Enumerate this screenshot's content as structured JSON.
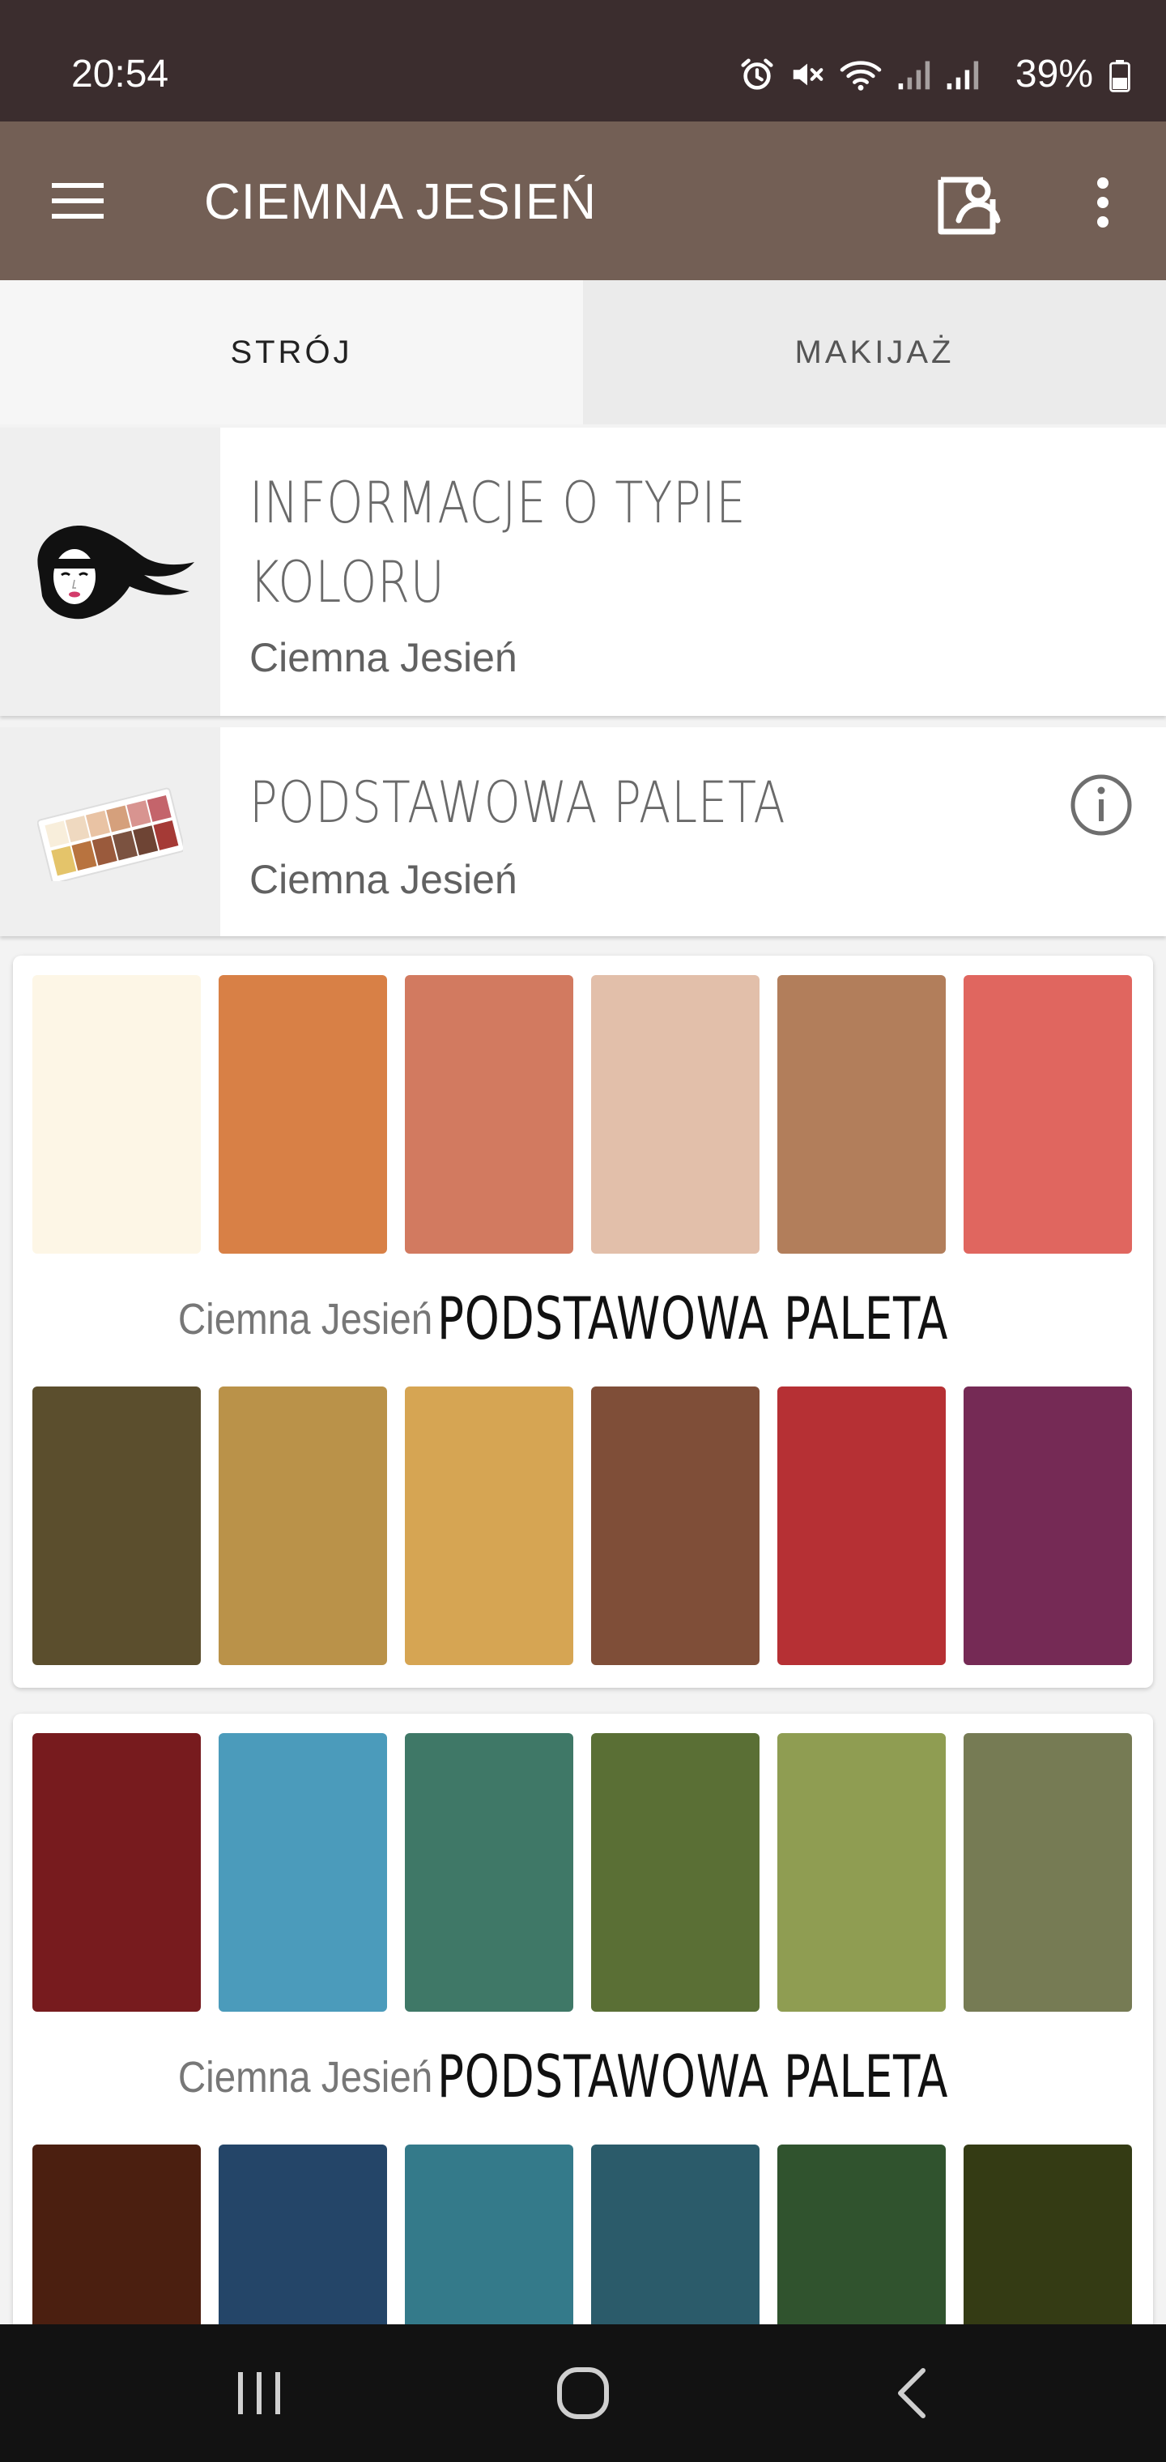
{
  "status_bar": {
    "time": "20:54",
    "battery": "39%",
    "icons": [
      "alarm-icon",
      "mute-icon",
      "wifi-icon",
      "signal-icon",
      "signal-icon",
      "battery-icon"
    ]
  },
  "app_bar": {
    "title": "CIEMNA JESIEŃ",
    "icons": [
      "menu-icon",
      "profile-icon",
      "more-vert-icon"
    ]
  },
  "tabs": [
    {
      "label": "STRÓJ",
      "selected": true
    },
    {
      "label": "MAKIJAŻ",
      "selected": false
    }
  ],
  "info_rows": [
    {
      "title_line1": "INFORMACJE O TYPIE",
      "title_line2": "KOLORU",
      "subtitle": "Ciemna Jesień",
      "icon": "woman-face-icon"
    },
    {
      "title": "PODSTAWOWA PALETA",
      "subtitle": "Ciemna Jesień",
      "icon": "color-palette-icon",
      "action_icon": "info-icon"
    }
  ],
  "palettes": [
    {
      "subtitle": "Ciemna Jesień",
      "title": "PODSTAWOWA PALETA",
      "top_colors": [
        "#fdf6e6",
        "#d88046",
        "#d27a60",
        "#e2bfaa",
        "#b27e5b",
        "#e0665f"
      ],
      "bottom_colors": [
        "#5b4e2d",
        "#ba9249",
        "#d6a553",
        "#7f4e38",
        "#b63034",
        "#752a55"
      ]
    },
    {
      "subtitle": "Ciemna Jesień",
      "title": "PODSTAWOWA PALETA",
      "top_colors": [
        "#771b1e",
        "#4b9bbb",
        "#3f7867",
        "#5a6f35",
        "#8f9d52",
        "#767b54"
      ],
      "bottom_colors": [
        "#4b1f10",
        "#244568",
        "#347a8a",
        "#2b5b6a",
        "#30532e",
        "#343b14"
      ]
    }
  ],
  "nav_bar": {
    "icons": [
      "recent-apps-icon",
      "home-icon",
      "back-icon"
    ]
  },
  "colors": {
    "status_bar": "#3b2d2e",
    "app_bar": "#735f55",
    "nav_bar": "#121212"
  }
}
